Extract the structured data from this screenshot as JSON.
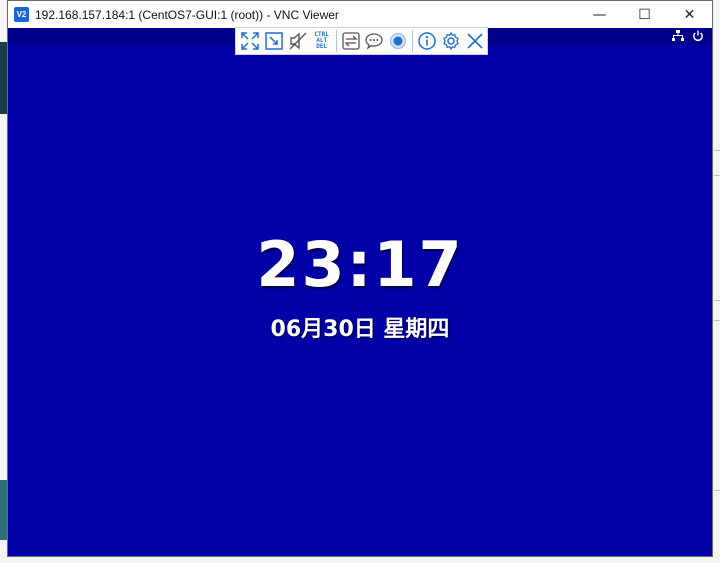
{
  "window": {
    "app_icon_text": "V2",
    "title": "192.168.157.184:1 (CentOS7-GUI:1 (root)) - VNC Viewer",
    "controls": {
      "minimize": "—",
      "maximize": "☐",
      "close": "✕"
    }
  },
  "toolbar": {
    "icons": [
      "fullscreen-icon",
      "scale-icon",
      "mute-audio-icon",
      "ctrl-alt-del-icon",
      "transfer-files-icon",
      "chat-icon",
      "record-icon",
      "info-icon",
      "settings-icon",
      "close-icon"
    ],
    "cad_lines": [
      "CTRL",
      "ALT",
      "DEL"
    ],
    "accent": "#1f6fd0"
  },
  "screen": {
    "background": "#0000a6",
    "topbar_color": "#00008b",
    "top_right_icons": [
      "network-icon",
      "power-icon"
    ],
    "time": "23:17",
    "date": "06月30日 星期四"
  }
}
